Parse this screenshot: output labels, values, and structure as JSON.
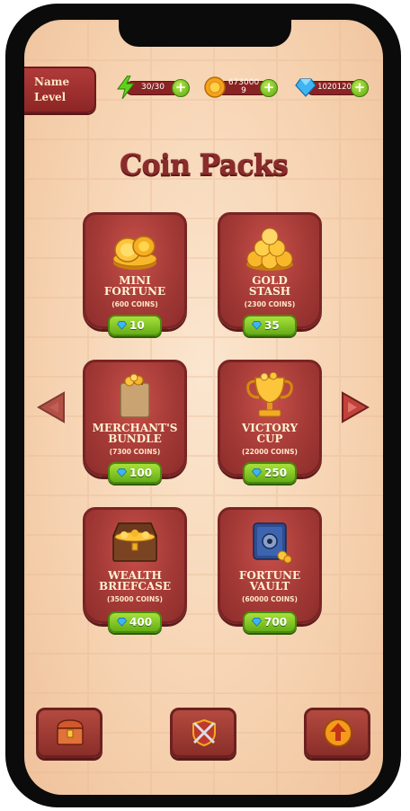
{
  "profile": {
    "name_label": "Name",
    "level_label": "Level"
  },
  "resources": {
    "energy": {
      "value": "30/30",
      "icon": "lightning-icon"
    },
    "coins": {
      "value": "673000 9",
      "icon": "coin-icon"
    },
    "gems": {
      "value": "1020120",
      "icon": "gem-icon"
    }
  },
  "title": "Coin Packs",
  "packs": [
    {
      "name_line1": "MINI",
      "name_line2": "FORTUNE",
      "coins": "(600 COINS)",
      "price": "10",
      "icon": "coin-stack-icon"
    },
    {
      "name_line1": "GOLD",
      "name_line2": "STASH",
      "coins": "(2300 COINS)",
      "price": "35",
      "icon": "coin-pile-icon"
    },
    {
      "name_line1": "MERCHANT'S",
      "name_line2": "BUNDLE",
      "coins": "(7300 COINS)",
      "price": "100",
      "icon": "coin-bag-icon"
    },
    {
      "name_line1": "VICTORY",
      "name_line2": "CUP",
      "coins": "(22000 COINS)",
      "price": "250",
      "icon": "trophy-cup-icon"
    },
    {
      "name_line1": "WEALTH",
      "name_line2": "BRIEFCASE",
      "coins": "(35000 COINS)",
      "price": "400",
      "icon": "treasure-chest-icon"
    },
    {
      "name_line1": "FORTUNE",
      "name_line2": "VAULT",
      "coins": "(60000 COINS)",
      "price": "700",
      "icon": "safe-vault-icon"
    }
  ],
  "nav": {
    "left": "treasure-chest-nav-icon",
    "center": "crossed-swords-shield-icon",
    "right": "upgrade-arrow-icon"
  },
  "colors": {
    "accent_red": "#a43a36",
    "button_green": "#64ae17",
    "title": "#8c2b2b"
  }
}
